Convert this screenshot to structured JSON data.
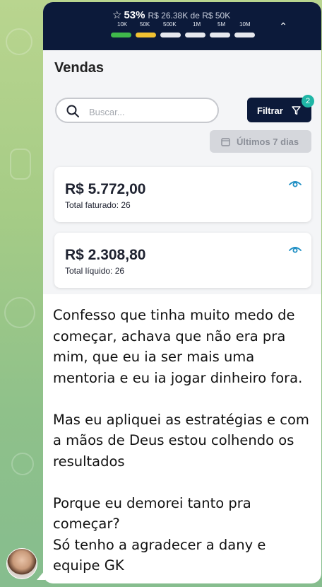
{
  "progress": {
    "percent": "53%",
    "amount_text": "R$ 26.38K de R$ 50K",
    "milestones": [
      "10K",
      "50K",
      "500K",
      "1M",
      "5M",
      "10M"
    ],
    "segment_colors": [
      "#3fb84b",
      "#f1c232",
      "#e6e8ee",
      "#e6e8ee",
      "#e6e8ee",
      "#e6e8ee"
    ],
    "icon": "star-icon",
    "toggle_icon": "chevron-up-icon"
  },
  "page": {
    "title": "Vendas"
  },
  "search": {
    "placeholder": "Buscar..."
  },
  "filter": {
    "label": "Filtrar",
    "badge": "2"
  },
  "date_filter": {
    "label": "Últimos 7 dias"
  },
  "cards": [
    {
      "value": "R$ 5.772,00",
      "caption": "Total faturado: 26"
    },
    {
      "value": "R$ 2.308,80",
      "caption": "Total líquido: 26"
    }
  ],
  "message": {
    "paragraphs": [
      "Confesso que tinha muito medo de começar, achava que não era pra mim, que eu ia ser mais uma mentoria e eu ia jogar dinheiro fora.",
      "Mas eu apliquei as estratégias e com a mãos de Deus estou colhendo os resultados",
      "Porque eu demorei tanto pra começar?",
      "Só tenho a agradecer a dany e equipe GK"
    ]
  },
  "colors": {
    "navy": "#0c1a3a",
    "teal": "#1fb6a6",
    "chat_bg": "#a6cc86"
  }
}
